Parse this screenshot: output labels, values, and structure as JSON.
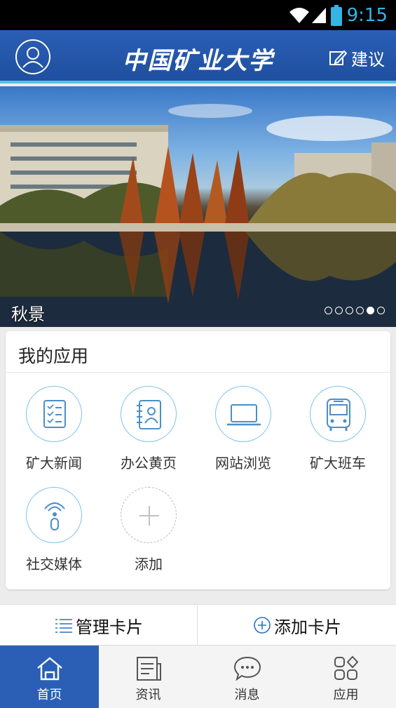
{
  "status_bar": {
    "time": "9:15",
    "icons": [
      "wifi-icon",
      "signal-icon",
      "battery-icon"
    ],
    "accent_color": "#33b5e5"
  },
  "header": {
    "logo_text": "中国矿业大学",
    "feedback_label": "建议",
    "bg_color": "#2a5fb5"
  },
  "banner": {
    "caption": "秋景",
    "slide_count": 6,
    "active_slide": 5
  },
  "my_apps": {
    "title": "我的应用",
    "items": [
      {
        "label": "矿大新闻",
        "icon": "news-icon"
      },
      {
        "label": "办公黄页",
        "icon": "directory-icon"
      },
      {
        "label": "网站浏览",
        "icon": "laptop-icon"
      },
      {
        "label": "矿大班车",
        "icon": "bus-icon"
      },
      {
        "label": "社交媒体",
        "icon": "social-media-icon"
      },
      {
        "label": "添加",
        "icon": "plus-icon"
      }
    ]
  },
  "actions": {
    "manage_label": "管理卡片",
    "add_label": "添加卡片"
  },
  "tabbar": {
    "tabs": [
      {
        "label": "首页",
        "icon": "home-icon",
        "active": true
      },
      {
        "label": "资讯",
        "icon": "news-tab-icon",
        "active": false
      },
      {
        "label": "消息",
        "icon": "message-icon",
        "active": false
      },
      {
        "label": "应用",
        "icon": "apps-icon",
        "active": false
      }
    ]
  }
}
